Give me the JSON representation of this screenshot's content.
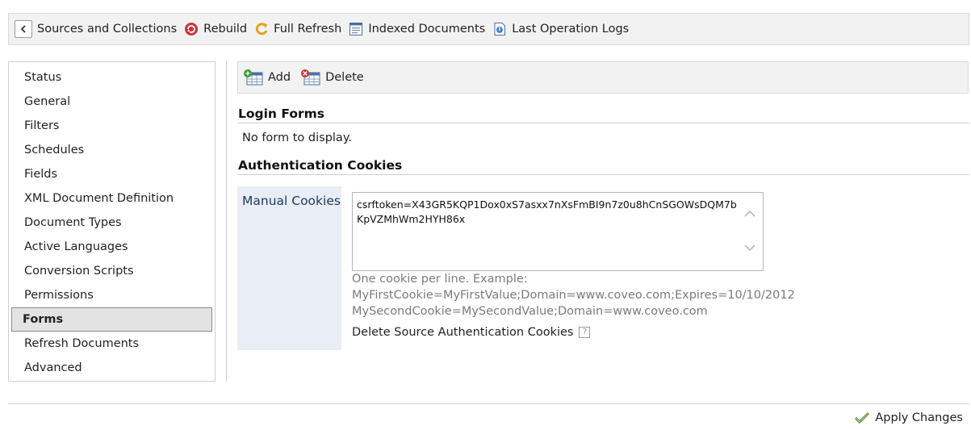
{
  "toolbar": {
    "items": [
      {
        "label": "Sources and Collections",
        "icon": "back-arrow-icon"
      },
      {
        "label": "Rebuild",
        "icon": "rebuild-icon"
      },
      {
        "label": "Full Refresh",
        "icon": "refresh-icon"
      },
      {
        "label": "Indexed Documents",
        "icon": "document-icon"
      },
      {
        "label": "Last Operation Logs",
        "icon": "log-icon"
      }
    ]
  },
  "sidebar": {
    "items": [
      {
        "label": "Status"
      },
      {
        "label": "General"
      },
      {
        "label": "Filters"
      },
      {
        "label": "Schedules"
      },
      {
        "label": "Fields"
      },
      {
        "label": "XML Document Definition"
      },
      {
        "label": "Document Types"
      },
      {
        "label": "Active Languages"
      },
      {
        "label": "Conversion Scripts"
      },
      {
        "label": "Permissions"
      },
      {
        "label": "Forms",
        "active": true
      },
      {
        "label": "Refresh Documents"
      },
      {
        "label": "Advanced"
      }
    ]
  },
  "actions": {
    "add_label": "Add",
    "delete_label": "Delete"
  },
  "login_forms": {
    "title": "Login Forms",
    "empty_message": "No form to display."
  },
  "auth_cookies": {
    "title": "Authentication Cookies",
    "manual_label": "Manual Cookies",
    "cookie_value": "csrftoken=X43GR5KQP1Dox0xS7asxx7nXsFmBI9n7z0u8hCnSGOWsDQM7bKpVZMhWm2HYH86x",
    "hint_line1": "One cookie per line. Example:",
    "hint_line2": "MyFirstCookie=MyFirstValue;Domain=www.coveo.com;Expires=10/10/2012",
    "hint_line3": "MySecondCookie=MySecondValue;Domain=www.coveo.com",
    "delete_link": "Delete Source Authentication Cookies",
    "help_glyph": "?"
  },
  "footer": {
    "apply_label": "Apply Changes"
  },
  "colors": {
    "accent_label": "#1b3a5e",
    "label_cell_bg": "#e9edf5",
    "toolbar_bg": "#f2f2f2",
    "active_item_bg": "#e3e3e3",
    "hint_text": "#7b7b7b"
  }
}
